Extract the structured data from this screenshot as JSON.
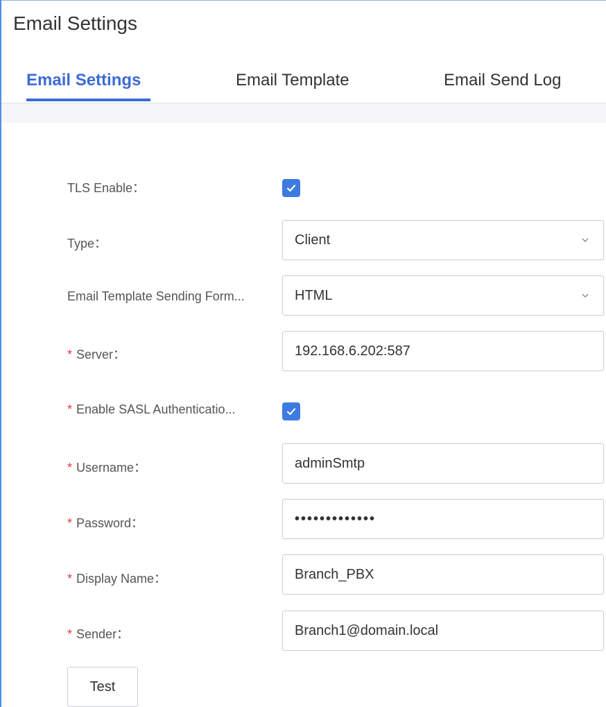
{
  "page": {
    "title": "Email Settings"
  },
  "tabs": [
    {
      "label": "Email Settings",
      "active": true
    },
    {
      "label": "Email Template",
      "active": false
    },
    {
      "label": "Email Send Log",
      "active": false
    }
  ],
  "form": {
    "tls_enable": {
      "label": "TLS Enable：",
      "checked": true
    },
    "type": {
      "label": "Type：",
      "value": "Client"
    },
    "sending_format": {
      "label": "Email Template Sending Form...",
      "value": "HTML"
    },
    "server": {
      "label": "Server：",
      "value": "192.168.6.202:587",
      "required": true
    },
    "sasl": {
      "label": "Enable SASL Authenticatio...",
      "checked": true,
      "required": true
    },
    "username": {
      "label": "Username：",
      "value": "adminSmtp",
      "required": true
    },
    "password": {
      "label": "Password：",
      "value": "•••••••••••••",
      "required": true
    },
    "display_name": {
      "label": "Display Name：",
      "value": "Branch_PBX",
      "required": true
    },
    "sender": {
      "label": "Sender：",
      "value": "Branch1@domain.local",
      "required": true
    },
    "required_mark": "*"
  },
  "buttons": {
    "test": "Test"
  },
  "colors": {
    "accent": "#3d6bd6",
    "checkbox": "#3d7be0",
    "required": "#e23b3b"
  }
}
